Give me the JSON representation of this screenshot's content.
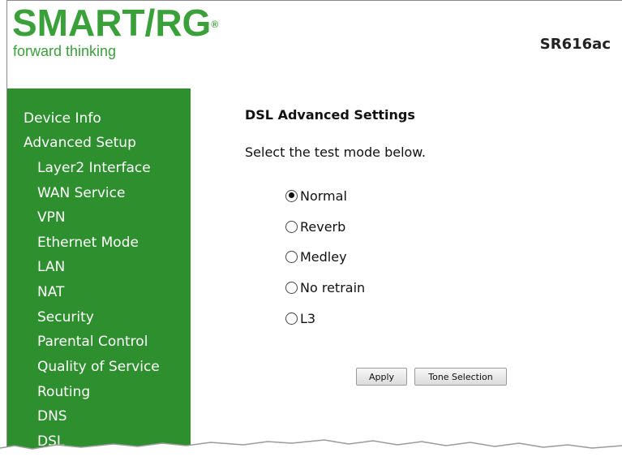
{
  "brand": {
    "logo_text": "SMART/RG",
    "registered": "®",
    "tagline": "forward thinking",
    "model": "SR616ac"
  },
  "sidebar": {
    "items": [
      {
        "label": "Device Info"
      },
      {
        "label": "Advanced Setup"
      },
      {
        "label": "Layer2 Interface"
      },
      {
        "label": "WAN Service"
      },
      {
        "label": "VPN"
      },
      {
        "label": "Ethernet Mode"
      },
      {
        "label": "LAN"
      },
      {
        "label": "NAT"
      },
      {
        "label": "Security"
      },
      {
        "label": "Parental Control"
      },
      {
        "label": "Quality of Service"
      },
      {
        "label": "Routing"
      },
      {
        "label": "DNS"
      },
      {
        "label": "DSL"
      }
    ]
  },
  "main": {
    "title": "DSL Advanced Settings",
    "instruction": "Select the test mode below.",
    "modes": [
      {
        "label": "Normal",
        "checked": true
      },
      {
        "label": "Reverb",
        "checked": false
      },
      {
        "label": "Medley",
        "checked": false
      },
      {
        "label": "No retrain",
        "checked": false
      },
      {
        "label": "L3",
        "checked": false
      }
    ],
    "buttons": {
      "apply": "Apply",
      "tone_selection": "Tone Selection"
    }
  },
  "colors": {
    "brand_green": "#3aa03a",
    "sidebar_green": "#2e8f2e"
  }
}
